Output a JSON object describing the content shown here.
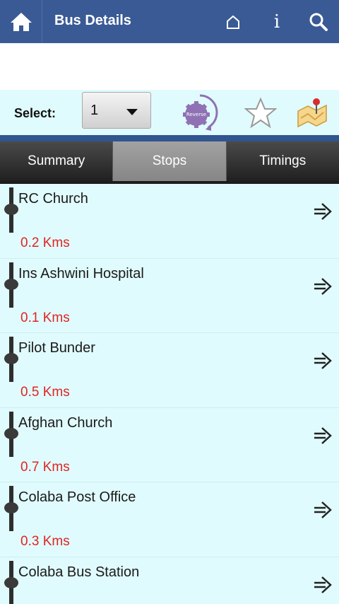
{
  "header": {
    "title": "Bus Details",
    "icons": [
      "home-icon",
      "house-outline-icon",
      "info-icon",
      "search-icon"
    ],
    "info_glyph": "i"
  },
  "select_row": {
    "label": "Select:",
    "selected_value": "1",
    "reverse_label": "Reverse",
    "icons": [
      "reverse-icon",
      "star-icon",
      "map-pin-icon"
    ]
  },
  "tabs": [
    {
      "label": "Summary",
      "active": false
    },
    {
      "label": "Stops",
      "active": true
    },
    {
      "label": "Timings",
      "active": false
    }
  ],
  "stops": [
    {
      "name": "RC Church",
      "distance": "0.2 Kms"
    },
    {
      "name": "Ins Ashwini Hospital",
      "distance": "0.1 Kms"
    },
    {
      "name": "Pilot Bunder",
      "distance": "0.5 Kms"
    },
    {
      "name": "Afghan Church",
      "distance": "0.7 Kms"
    },
    {
      "name": "Colaba Post Office",
      "distance": "0.3 Kms"
    },
    {
      "name": "Colaba Bus Station",
      "distance": ""
    }
  ],
  "colors": {
    "header_bg": "#3a5a95",
    "list_bg": "#e0fbfd",
    "distance_text": "#e02424",
    "reverse_gear": "#8f72b4"
  }
}
